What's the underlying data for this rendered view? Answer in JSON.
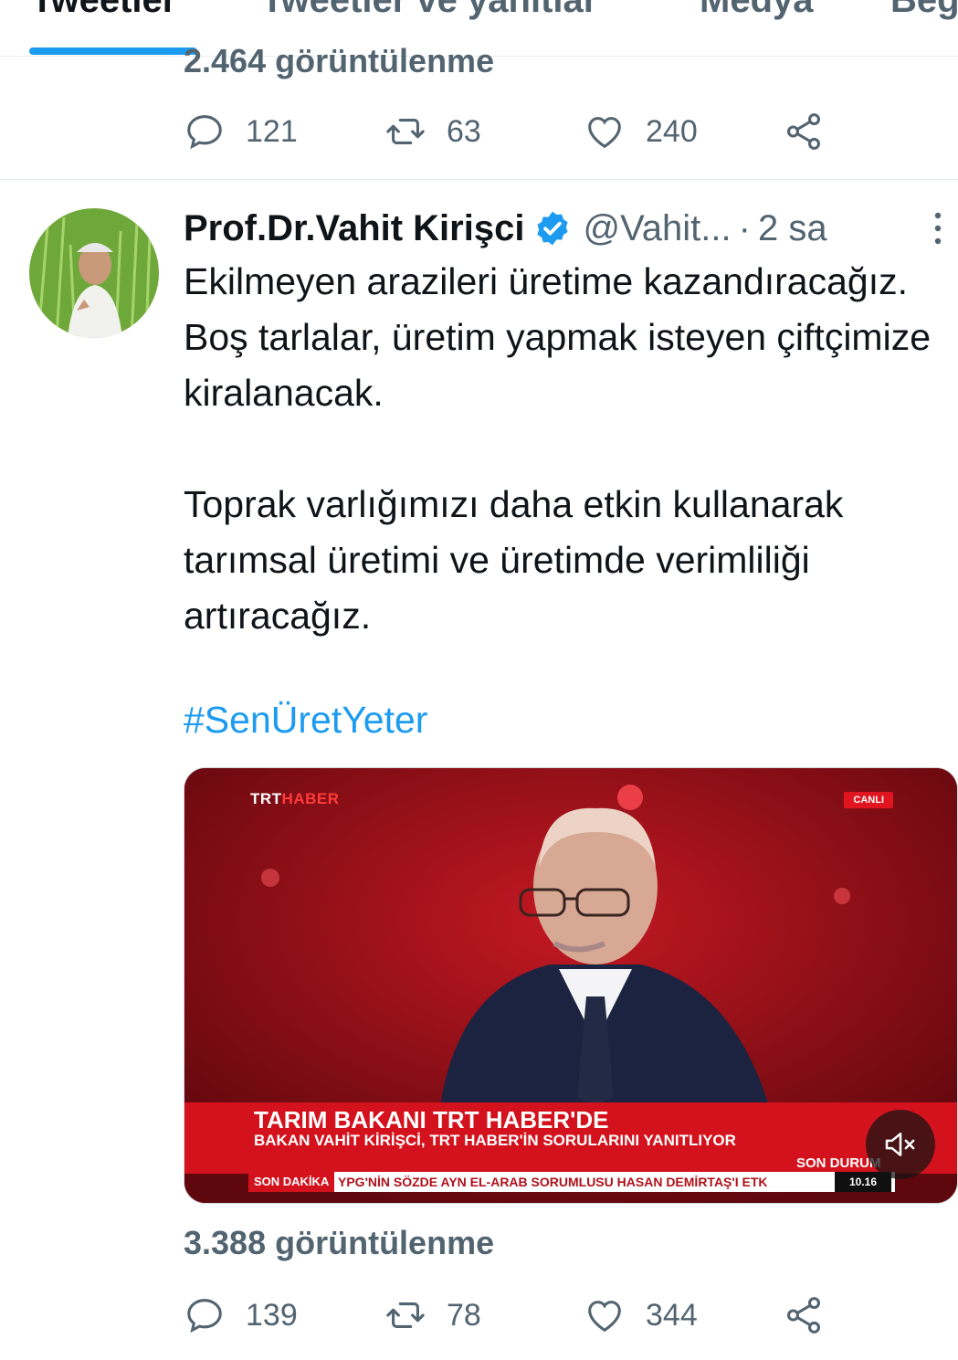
{
  "tabs": [
    {
      "label": "Tweetler",
      "active": true
    },
    {
      "label": "Tweetler ve yanıtlar",
      "active": false
    },
    {
      "label": "Medya",
      "active": false
    },
    {
      "label": "Beğ",
      "active": false
    }
  ],
  "previous_tweet": {
    "views_text": "2.464 görüntülenme",
    "replies": "121",
    "retweets": "63",
    "likes": "240"
  },
  "tweet": {
    "author_name": "Prof.Dr.Vahit Kirişci",
    "handle": "@Vahit...",
    "separator": "·",
    "time": "2 sa",
    "paragraphs": [
      "Ekilmeyen arazileri üretime kazandıracağız. Boş tarlalar, üretim yapmak isteyen çiftçimize kiralanacak.",
      "Toprak varlığımızı daha etkin kullanarak tarımsal üretimi ve üretimde verimliliği artıracağız."
    ],
    "hashtag": "#SenÜretYeter",
    "media": {
      "brand_white": "TRT",
      "brand_red": "HABER",
      "live_badge": "CANLI",
      "headline": "TARIM BAKANI TRT HABER'DE",
      "subheadline": "BAKAN VAHİT KİRİŞCİ, TRT HABER'İN SORULARINI YANITLIYOR",
      "son_durum": "SON DURUM",
      "ticker_label": "SON DAKİKA",
      "ticker_text": "YPG'NİN SÖZDE AYN EL-ARAB SORUMLUSU HASAN DEMİRTAŞ'I ETK",
      "ticker_time": "10.16"
    },
    "views_count": "3.388",
    "views_label": "görüntülenme",
    "replies": "139",
    "retweets": "78",
    "likes": "344"
  },
  "colors": {
    "accent": "#1d9bf0",
    "secondary_text": "#536471",
    "trt_red": "#d3121d"
  },
  "icons": [
    "reply-icon",
    "retweet-icon",
    "like-icon",
    "share-icon",
    "verified-badge-icon",
    "more-options-icon",
    "mute-icon"
  ]
}
